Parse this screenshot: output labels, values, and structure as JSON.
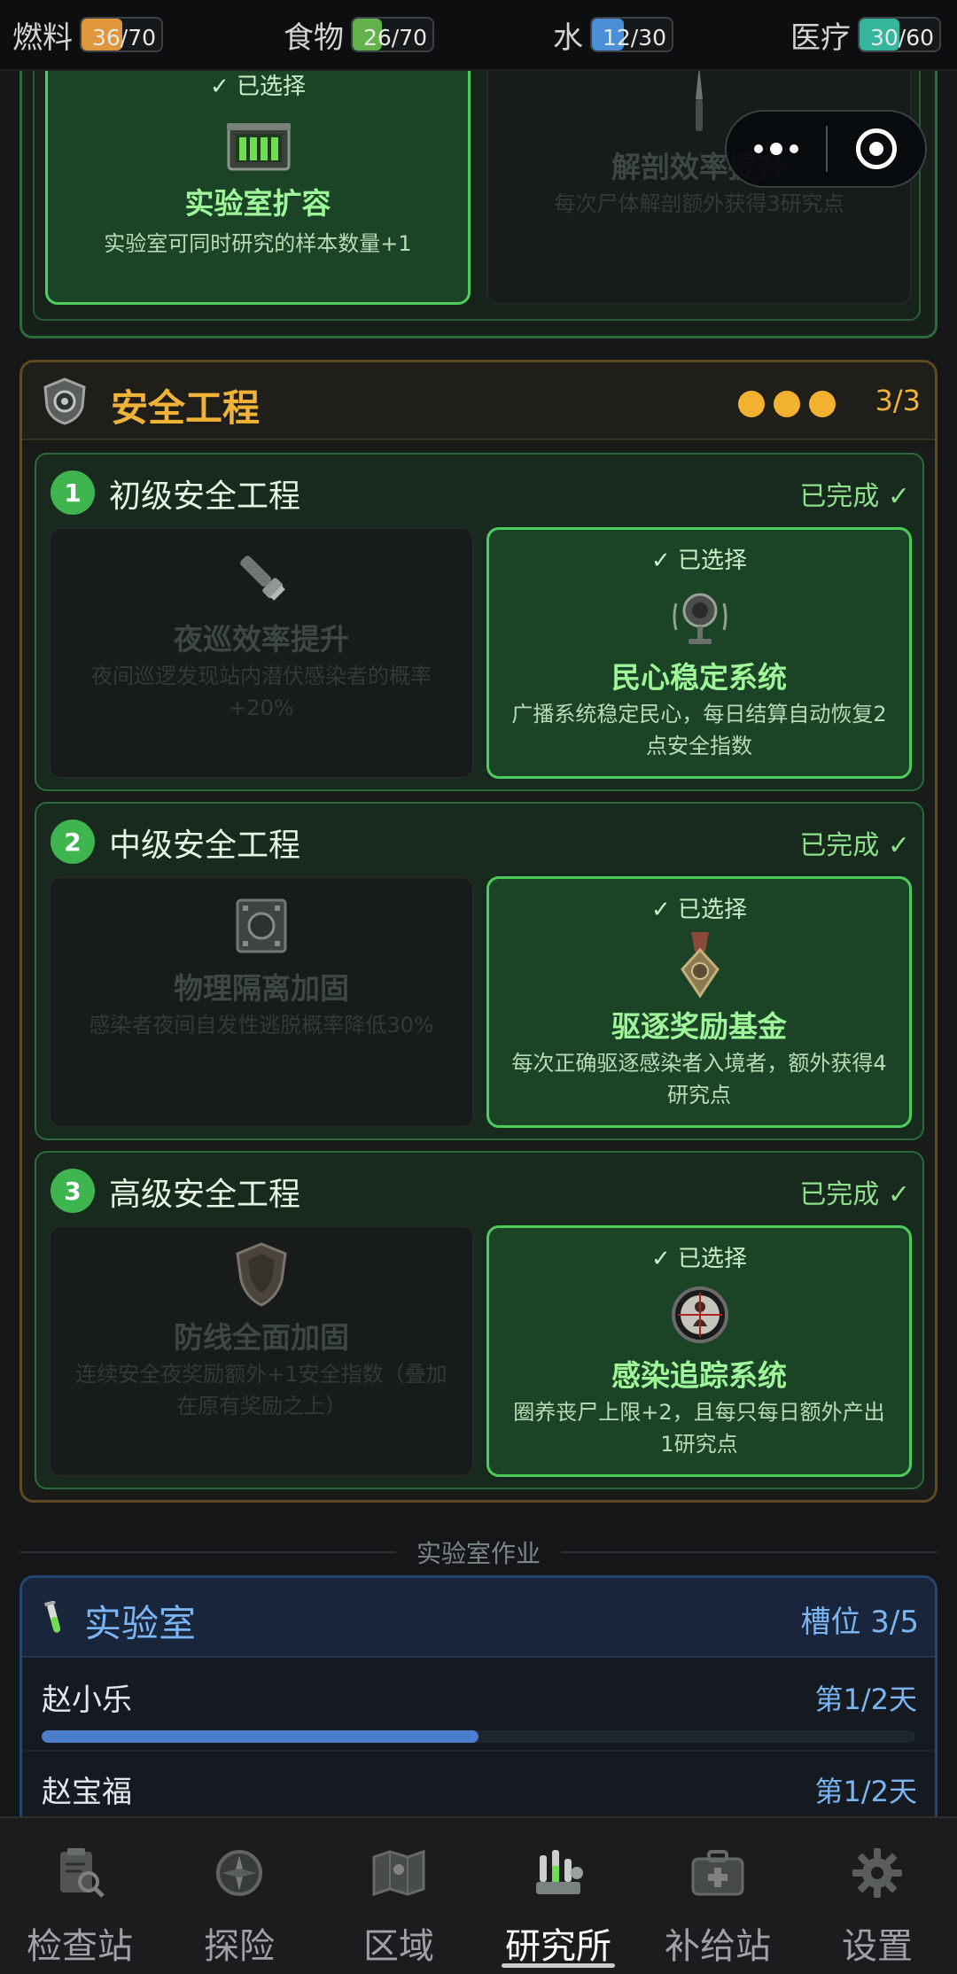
{
  "resources": [
    {
      "label": "燃料",
      "value": "36/70",
      "fill": 0.51,
      "color": "#e0963a"
    },
    {
      "label": "食物",
      "value": "26/70",
      "fill": 0.37,
      "color": "#63b14b"
    },
    {
      "label": "水",
      "value": "12/30",
      "fill": 0.4,
      "color": "#4a8fd8"
    },
    {
      "label": "医疗",
      "value": "30/60",
      "fill": 0.5,
      "color": "#36b59d"
    }
  ],
  "prev_cards": {
    "left": {
      "selected_label": "✓ 已选择",
      "title": "实验室扩容",
      "desc": "实验室可同时研究的样本数量+1",
      "icon": "sample-crate-icon"
    },
    "right": {
      "title": "解剖效率提升",
      "desc": "每次尸体解剖额外获得3研究点",
      "icon": "scalpel-icon"
    }
  },
  "security": {
    "title": "安全工程",
    "progress": "3/3",
    "accent": "#f1b238",
    "tiers": [
      {
        "num": "1",
        "name": "初级安全工程",
        "status": "已完成 ✓",
        "left": {
          "title": "夜巡效率提升",
          "desc": "夜间巡逻发现站内潜伏感染者的概率+20%",
          "icon": "flashlight-icon"
        },
        "right": {
          "selected_label": "✓ 已选择",
          "title": "民心稳定系统",
          "desc": "广播系统稳定民心，每日结算自动恢复2点安全指数",
          "icon": "loudspeaker-icon"
        }
      },
      {
        "num": "2",
        "name": "中级安全工程",
        "status": "已完成 ✓",
        "left": {
          "title": "物理隔离加固",
          "desc": "感染者夜间自发性逃脱概率降低30%",
          "icon": "vault-door-icon"
        },
        "right": {
          "selected_label": "✓ 已选择",
          "title": "驱逐奖励基金",
          "desc": "每次正确驱逐感染者入境者，额外获得4研究点",
          "icon": "medal-icon"
        }
      },
      {
        "num": "3",
        "name": "高级安全工程",
        "status": "已完成 ✓",
        "left": {
          "title": "防线全面加固",
          "desc": "连续安全夜奖励额外+1安全指数（叠加在原有奖励之上）",
          "icon": "armor-shield-icon"
        },
        "right": {
          "selected_label": "✓ 已选择",
          "title": "感染追踪系统",
          "desc": "圈养丧尸上限+2，且每只每日额外产出1研究点",
          "icon": "scope-icon"
        }
      }
    ]
  },
  "divider_label": "实验室作业",
  "lab": {
    "title": "实验室",
    "slots": "槽位 3/5",
    "accent": "#7ab5f2",
    "rows": [
      {
        "name": "赵小乐",
        "day": "第1/2天",
        "progress": 0.5
      },
      {
        "name": "赵宝福",
        "day": "第1/2天",
        "progress": 0.5
      }
    ]
  },
  "nav": {
    "items": [
      {
        "label": "检查站",
        "icon": "clipboard-search-icon"
      },
      {
        "label": "探险",
        "icon": "compass-icon"
      },
      {
        "label": "区域",
        "icon": "map-icon"
      },
      {
        "label": "研究所",
        "icon": "lab-equipment-icon"
      },
      {
        "label": "补给站",
        "icon": "supply-case-icon"
      },
      {
        "label": "设置",
        "icon": "gear-icon"
      }
    ],
    "active": "研究所"
  }
}
